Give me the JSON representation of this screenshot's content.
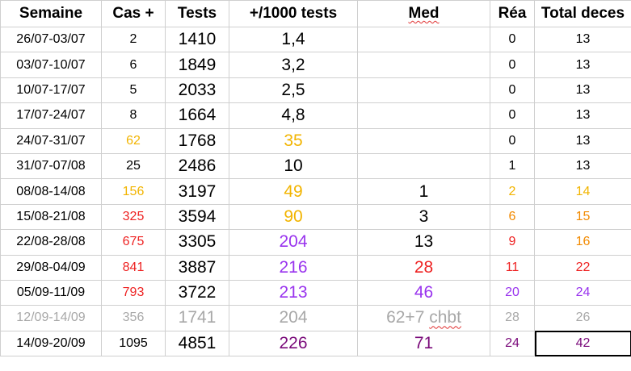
{
  "headers": {
    "week": "Semaine",
    "cases": "Cas +",
    "tests": "Tests",
    "ratio": "+/1000 tests",
    "med": "Med",
    "rea": "Réa",
    "deaths": "Total deces"
  },
  "colors": {
    "black": "#000000",
    "yellow": "#f2b400",
    "red": "#ee2222",
    "orange": "#f28a00",
    "purple": "#9933ee",
    "gray": "#a8a8a8",
    "darkpurple": "#7a0a7a"
  },
  "rows": [
    {
      "week": "26/07-03/07",
      "cases": "2",
      "tests": "1410",
      "ratio": "1,4",
      "med": "",
      "rea": "0",
      "deaths": "13",
      "c": {
        "week": "black",
        "cases": "black",
        "tests": "black",
        "ratio": "black",
        "med": "black",
        "rea": "black",
        "deaths": "black"
      }
    },
    {
      "week": "03/07-10/07",
      "cases": "6",
      "tests": "1849",
      "ratio": "3,2",
      "med": "",
      "rea": "0",
      "deaths": "13",
      "c": {
        "week": "black",
        "cases": "black",
        "tests": "black",
        "ratio": "black",
        "med": "black",
        "rea": "black",
        "deaths": "black"
      }
    },
    {
      "week": "10/07-17/07",
      "cases": "5",
      "tests": "2033",
      "ratio": "2,5",
      "med": "",
      "rea": "0",
      "deaths": "13",
      "c": {
        "week": "black",
        "cases": "black",
        "tests": "black",
        "ratio": "black",
        "med": "black",
        "rea": "black",
        "deaths": "black"
      }
    },
    {
      "week": "17/07-24/07",
      "cases": "8",
      "tests": "1664",
      "ratio": "4,8",
      "med": "",
      "rea": "0",
      "deaths": "13",
      "c": {
        "week": "black",
        "cases": "black",
        "tests": "black",
        "ratio": "black",
        "med": "black",
        "rea": "black",
        "deaths": "black"
      }
    },
    {
      "week": "24/07-31/07",
      "cases": "62",
      "tests": "1768",
      "ratio": "35",
      "med": "",
      "rea": "0",
      "deaths": "13",
      "c": {
        "week": "black",
        "cases": "yellow",
        "tests": "black",
        "ratio": "yellow",
        "med": "black",
        "rea": "black",
        "deaths": "black"
      }
    },
    {
      "week": "31/07-07/08",
      "cases": "25",
      "tests": "2486",
      "ratio": "10",
      "med": "",
      "rea": "1",
      "deaths": "13",
      "c": {
        "week": "black",
        "cases": "black",
        "tests": "black",
        "ratio": "black",
        "med": "black",
        "rea": "black",
        "deaths": "black"
      }
    },
    {
      "week": "08/08-14/08",
      "cases": "156",
      "tests": "3197",
      "ratio": "49",
      "med": "1",
      "rea": "2",
      "deaths": "14",
      "c": {
        "week": "black",
        "cases": "yellow",
        "tests": "black",
        "ratio": "yellow",
        "med": "black",
        "rea": "yellow",
        "deaths": "yellow"
      }
    },
    {
      "week": "15/08-21/08",
      "cases": "325",
      "tests": "3594",
      "ratio": "90",
      "med": "3",
      "rea": "6",
      "deaths": "15",
      "c": {
        "week": "black",
        "cases": "red",
        "tests": "black",
        "ratio": "yellow",
        "med": "black",
        "rea": "orange",
        "deaths": "orange"
      }
    },
    {
      "week": "22/08-28/08",
      "cases": "675",
      "tests": "3305",
      "ratio": "204",
      "med": "13",
      "rea": "9",
      "deaths": "16",
      "c": {
        "week": "black",
        "cases": "red",
        "tests": "black",
        "ratio": "purple",
        "med": "black",
        "rea": "red",
        "deaths": "orange"
      }
    },
    {
      "week": "29/08-04/09",
      "cases": "841",
      "tests": "3887",
      "ratio": "216",
      "med": "28",
      "rea": "11",
      "deaths": "22",
      "c": {
        "week": "black",
        "cases": "red",
        "tests": "black",
        "ratio": "purple",
        "med": "red",
        "rea": "red",
        "deaths": "red"
      }
    },
    {
      "week": "05/09-11/09",
      "cases": "793",
      "tests": "3722",
      "ratio": "213",
      "med": "46",
      "rea": "20",
      "deaths": "24",
      "c": {
        "week": "black",
        "cases": "red",
        "tests": "black",
        "ratio": "purple",
        "med": "purple",
        "rea": "purple",
        "deaths": "purple"
      }
    },
    {
      "week": "12/09-14/09",
      "cases": "356",
      "tests": "1741",
      "ratio": "204",
      "med": "62+7 chbt",
      "rea": "28",
      "deaths": "26",
      "c": {
        "week": "gray",
        "cases": "gray",
        "tests": "gray",
        "ratio": "gray",
        "med": "gray",
        "rea": "gray",
        "deaths": "gray"
      }
    },
    {
      "week": "14/09-20/09",
      "cases": "1095",
      "tests": "4851",
      "ratio": "226",
      "med": "71",
      "rea": "24",
      "deaths": "42",
      "c": {
        "week": "black",
        "cases": "black",
        "tests": "black",
        "ratio": "darkpurple",
        "med": "darkpurple",
        "rea": "darkpurple",
        "deaths": "darkpurple"
      }
    }
  ]
}
